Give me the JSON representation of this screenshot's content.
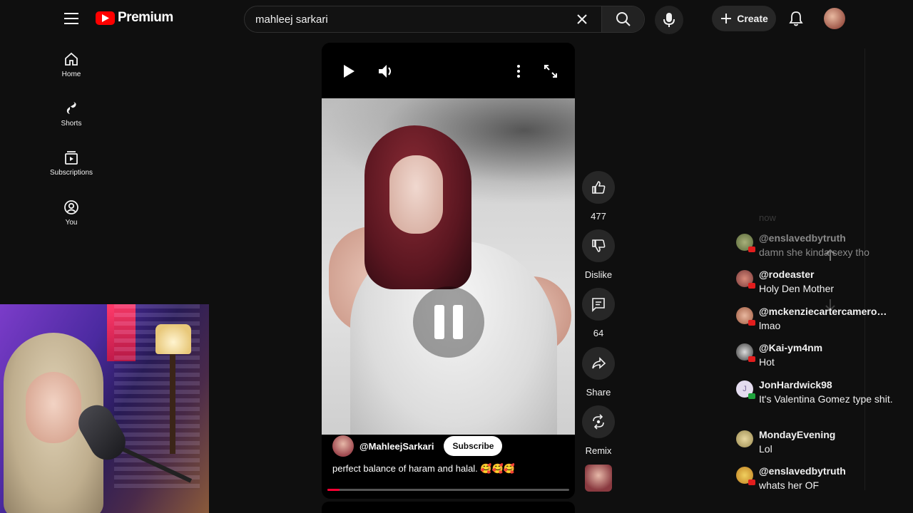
{
  "header": {
    "logo_text": "Premium",
    "search": {
      "value": "mahleej sarkari",
      "placeholder": "Search"
    },
    "create_label": "Create"
  },
  "nav": {
    "items": [
      {
        "label": "Home",
        "icon": "home-icon"
      },
      {
        "label": "Shorts",
        "icon": "shorts-icon"
      },
      {
        "label": "Subscriptions",
        "icon": "subscriptions-icon"
      },
      {
        "label": "You",
        "icon": "you-icon"
      }
    ]
  },
  "player": {
    "channel": "@MahleejSarkari",
    "subscribe_label": "Subscribe",
    "caption": "perfect balance of haram and halal. 🥰🥰🥰",
    "progress": 0.05
  },
  "actions": {
    "like_count": "477",
    "dislike_label": "Dislike",
    "comment_count": "64",
    "share_label": "Share",
    "remix_label": "Remix"
  },
  "chat": {
    "now_label": "now",
    "messages": [
      {
        "user": "@enslavedbytruth",
        "text": "damn she kinda sexy tho",
        "faded": true
      },
      {
        "user": "@rodeaster",
        "text": "Holy Den Mother"
      },
      {
        "user": "@mckenziecartercamero…",
        "text": "lmao"
      },
      {
        "user": "@Kai-ym4nm",
        "text": "Hot"
      },
      {
        "user": "JonHardwick98",
        "text": "It's Valentina Gomez type shit."
      },
      {
        "user": "MondayEvening",
        "text": "Lol"
      },
      {
        "user": "@enslavedbytruth",
        "text": "whats her OF"
      }
    ]
  },
  "colors": {
    "accent": "#ff0033",
    "background": "#0f0f0f",
    "youtube_red": "#ff0000"
  }
}
